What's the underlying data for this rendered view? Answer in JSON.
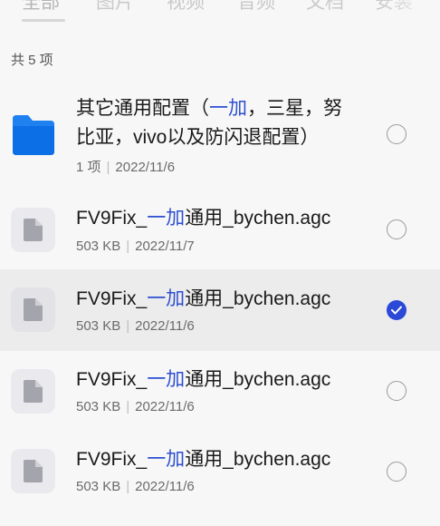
{
  "tabs": [
    {
      "label": "全部",
      "active": true
    },
    {
      "label": "图片",
      "active": false
    },
    {
      "label": "视频",
      "active": false
    },
    {
      "label": "音频",
      "active": false
    },
    {
      "label": "文档",
      "active": false
    },
    {
      "label": "安装",
      "active": false
    }
  ],
  "count_label": "共 5 项",
  "items": [
    {
      "type": "folder",
      "name_line1_pre": "其它通用配置（",
      "name_line1_hl": "一加",
      "name_line1_post": "，三星，努",
      "name_line2": "比亚，vivo以及防闪退配置）",
      "meta_left": "1 项",
      "meta_sep": "|",
      "meta_right": "2022/11/6",
      "checked": false
    },
    {
      "type": "file",
      "name_pre": "FV9Fix_",
      "name_hl": "一加",
      "name_post": "通用_bychen.agc",
      "meta_left": "503 KB",
      "meta_sep": "|",
      "meta_right": "2022/11/7",
      "checked": false
    },
    {
      "type": "file",
      "name_pre": "FV9Fix_",
      "name_hl": "一加",
      "name_post": "通用_bychen.agc",
      "meta_left": "503 KB",
      "meta_sep": "|",
      "meta_right": "2022/11/6",
      "checked": true
    },
    {
      "type": "file",
      "name_pre": "FV9Fix_",
      "name_hl": "一加",
      "name_post": "通用_bychen.agc",
      "meta_left": "503 KB",
      "meta_sep": "|",
      "meta_right": "2022/11/6",
      "checked": false
    },
    {
      "type": "file",
      "name_pre": "FV9Fix_",
      "name_hl": "一加",
      "name_post": "通用_bychen.agc",
      "meta_left": "503 KB",
      "meta_sep": "|",
      "meta_right": "2022/11/6",
      "checked": false
    }
  ],
  "colors": {
    "accent": "#2b48d6",
    "highlight_text": "#2d4fd1",
    "folder": "#1f80f0",
    "selected_row": "#ececec"
  },
  "icons": {
    "folder": "folder-icon",
    "file": "file-icon",
    "checked": "check-icon"
  }
}
